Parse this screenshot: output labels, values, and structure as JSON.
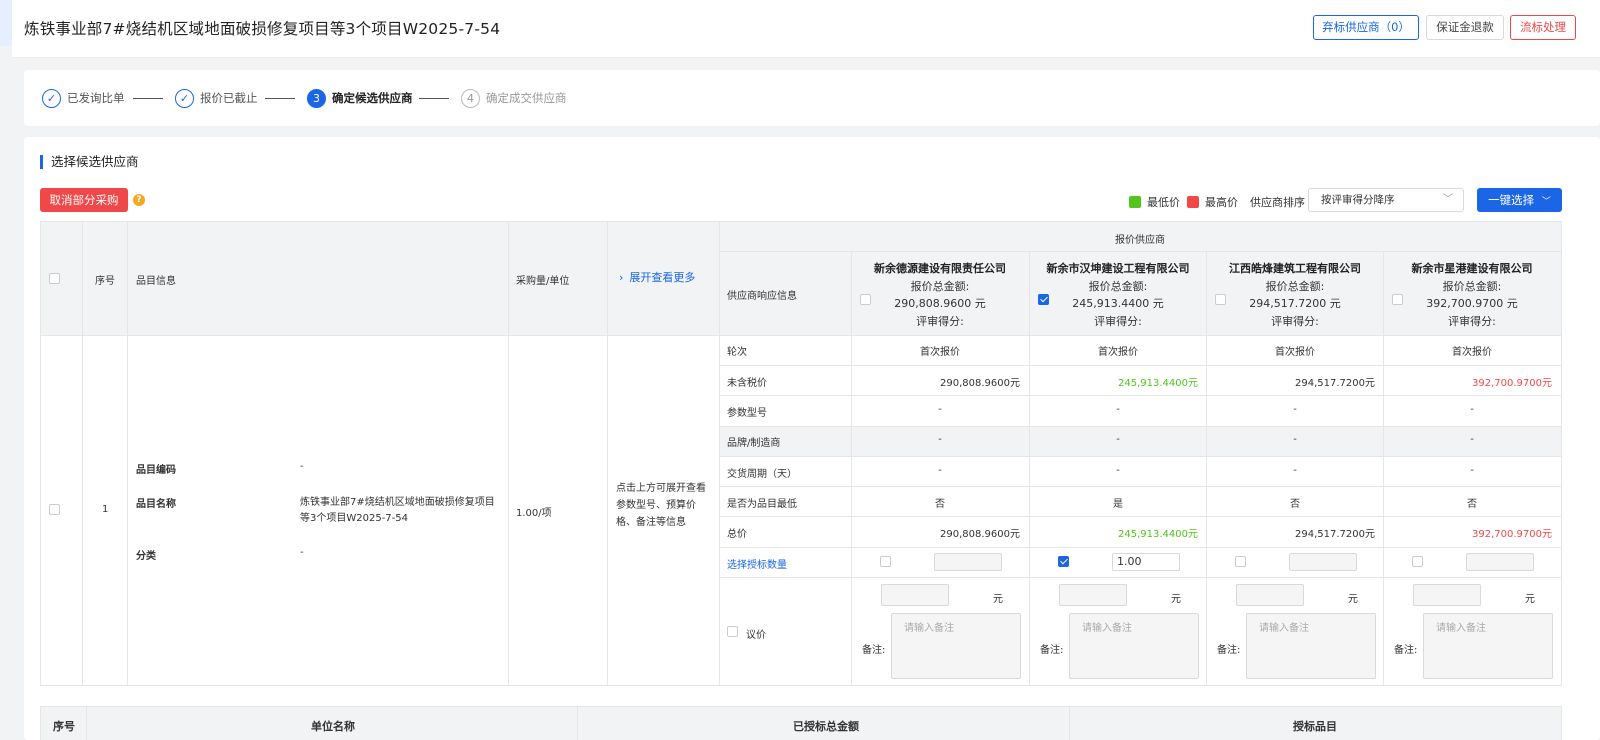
{
  "page": {
    "title": "炼铁事业部7#烧结机区域地面破损修复项目等3个项目W2025-7-54",
    "buttons": {
      "abandon": "弃标供应商（0）",
      "refund": "保证金退款",
      "fail": "流标处理"
    }
  },
  "steps": [
    {
      "num": "✓",
      "label": "已发询比单",
      "state": "done"
    },
    {
      "num": "✓",
      "label": "报价已截止",
      "state": "done"
    },
    {
      "num": "3",
      "label": "确定候选供应商",
      "state": "active"
    },
    {
      "num": "4",
      "label": "确定成交供应商",
      "state": "todo"
    }
  ],
  "section": {
    "title": "选择候选供应商",
    "cancel_button": "取消部分采购",
    "help": "?",
    "legend_low": "最低价",
    "legend_high": "最高价",
    "legend_low_color": "#52c41a",
    "legend_high_color": "#f04848",
    "sort_label": "供应商排序",
    "sort_value": "按评审得分降序",
    "one_click": "一键选择"
  },
  "table": {
    "headers": {
      "seq": "序号",
      "item_info": "品目信息",
      "qty_unit": "采购量/单位",
      "expand": "展开查看更多",
      "group": "报价供应商",
      "response": "供应商响应信息"
    },
    "item": {
      "seq": "1",
      "code_label": "品目编码",
      "code_value": "-",
      "name_label": "品目名称",
      "name_value": "炼铁事业部7#烧结机区域地面破损修复项目等3个项目W2025-7-54",
      "cat_label": "分类",
      "cat_value": "-",
      "qty": "1.00/项",
      "expand_hint": "点击上方可展开查看参数型号、预算价格、备注等信息"
    },
    "row_labels": [
      "轮次",
      "未含税价",
      "参数型号",
      "品牌/制造商",
      "交货周期（天）",
      "是否为品目最低",
      "总价"
    ],
    "select_label": "选择授标数量",
    "negotiate_label": "议价",
    "yuan": "元",
    "remark_label": "备注:",
    "remark_placeholder": "请输入备注",
    "total_label": "报价总金额:",
    "score_label": "评审得分:",
    "suppliers": [
      {
        "name": "新余德源建设有限责任公司",
        "total": "290,808.9600 元",
        "checked": false,
        "round": "首次报价",
        "untaxed": "290,808.9600元",
        "untaxed_color": "normal",
        "param": "-",
        "brand": "-",
        "delivery": "-",
        "is_lowest": "否",
        "price": "290,808.9600元",
        "qty": ""
      },
      {
        "name": "新余市汉坤建设工程有限公司",
        "total": "245,913.4400 元",
        "checked": true,
        "round": "首次报价",
        "untaxed": "245,913.4400元",
        "untaxed_color": "green",
        "param": "-",
        "brand": "-",
        "delivery": "-",
        "is_lowest": "是",
        "price": "245,913.4400元",
        "qty": "1.00"
      },
      {
        "name": "江西皓烽建筑工程有限公司",
        "total": "294,517.7200 元",
        "checked": false,
        "round": "首次报价",
        "untaxed": "294,517.7200元",
        "untaxed_color": "normal",
        "param": "-",
        "brand": "-",
        "delivery": "-",
        "is_lowest": "否",
        "price": "294,517.7200元",
        "qty": ""
      },
      {
        "name": "新余市星港建设有限公司",
        "total": "392,700.9700 元",
        "checked": false,
        "round": "首次报价",
        "untaxed": "392,700.9700元",
        "untaxed_color": "red",
        "param": "-",
        "brand": "-",
        "delivery": "-",
        "is_lowest": "否",
        "price": "392,700.9700元",
        "qty": ""
      }
    ]
  },
  "bottom": {
    "seq": "序号",
    "unit": "单位名称",
    "amount": "已授标总金额",
    "item": "授标品目"
  }
}
